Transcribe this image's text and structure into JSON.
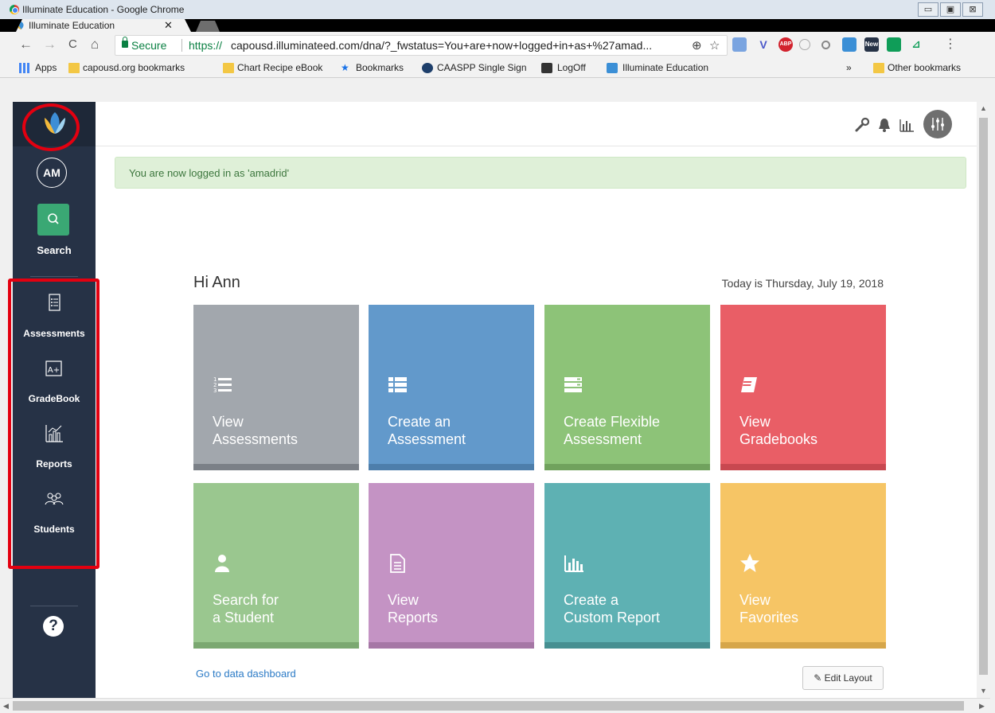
{
  "window": {
    "title": "Illuminate Education - Google Chrome",
    "minimize": "▭",
    "maximize": "▣",
    "close": "⊠"
  },
  "tab": {
    "title": "Illuminate Education",
    "close": "✕"
  },
  "toolbar": {
    "back": "←",
    "forward": "→",
    "reload": "C",
    "home": "⌂",
    "secure_label": "Secure",
    "url_scheme": "https://",
    "url_rest": "capousd.illuminateed.com/dna/?_fwstatus=You+are+now+logged+in+as+%27amad...",
    "zoom_icon": "⊕",
    "star_icon": "☆",
    "menu_icon": "⋮",
    "ext_new_badge": "New",
    "ext_abp": "ABP"
  },
  "bookmarks": {
    "apps": "Apps",
    "items": [
      "capousd.org bookmarks",
      "Chart Recipe eBook",
      "Bookmarks",
      "CAASPP Single Sign",
      "LogOff",
      "Illuminate Education"
    ],
    "overflow": "»",
    "other": "Other bookmarks"
  },
  "sidebar": {
    "avatar_initials": "AM",
    "search": "Search",
    "items": [
      {
        "label": "Assessments"
      },
      {
        "label": "GradeBook"
      },
      {
        "label": "Reports"
      },
      {
        "label": "Students"
      }
    ],
    "help": "?"
  },
  "alert": {
    "text": "You are now logged in as 'amadrid'"
  },
  "greeting": "Hi Ann",
  "today": "Today is Thursday, July 19, 2018",
  "tiles": [
    {
      "line1": "View",
      "line2": "Assessments",
      "color": "#a2a7ad",
      "strip": "#7b8087",
      "icon": "numbered-list-icon"
    },
    {
      "line1": "Create an",
      "line2": "Assessment",
      "color": "#6299cb",
      "strip": "#4d7eab",
      "icon": "list-icon"
    },
    {
      "line1": "Create Flexible",
      "line2": "Assessment",
      "color": "#8dc378",
      "strip": "#70a25d",
      "icon": "server-icon"
    },
    {
      "line1": "View",
      "line2": "Gradebooks",
      "color": "#e95e66",
      "strip": "#c84850",
      "icon": "book-icon"
    },
    {
      "line1": "Search for",
      "line2": "a Student",
      "color": "#9ac78f",
      "strip": "#7ba871",
      "icon": "user-icon"
    },
    {
      "line1": "View",
      "line2": "Reports",
      "color": "#c493c4",
      "strip": "#a577a5",
      "icon": "document-icon"
    },
    {
      "line1": "Create a",
      "line2": "Custom Report",
      "color": "#5eb1b3",
      "strip": "#468f91",
      "icon": "bar-chart-icon"
    },
    {
      "line1": "View",
      "line2": "Favorites",
      "color": "#f6c565",
      "strip": "#d6a64a",
      "icon": "star-icon"
    }
  ],
  "dashboard_link": "Go to data dashboard",
  "edit_layout": "Edit Layout"
}
